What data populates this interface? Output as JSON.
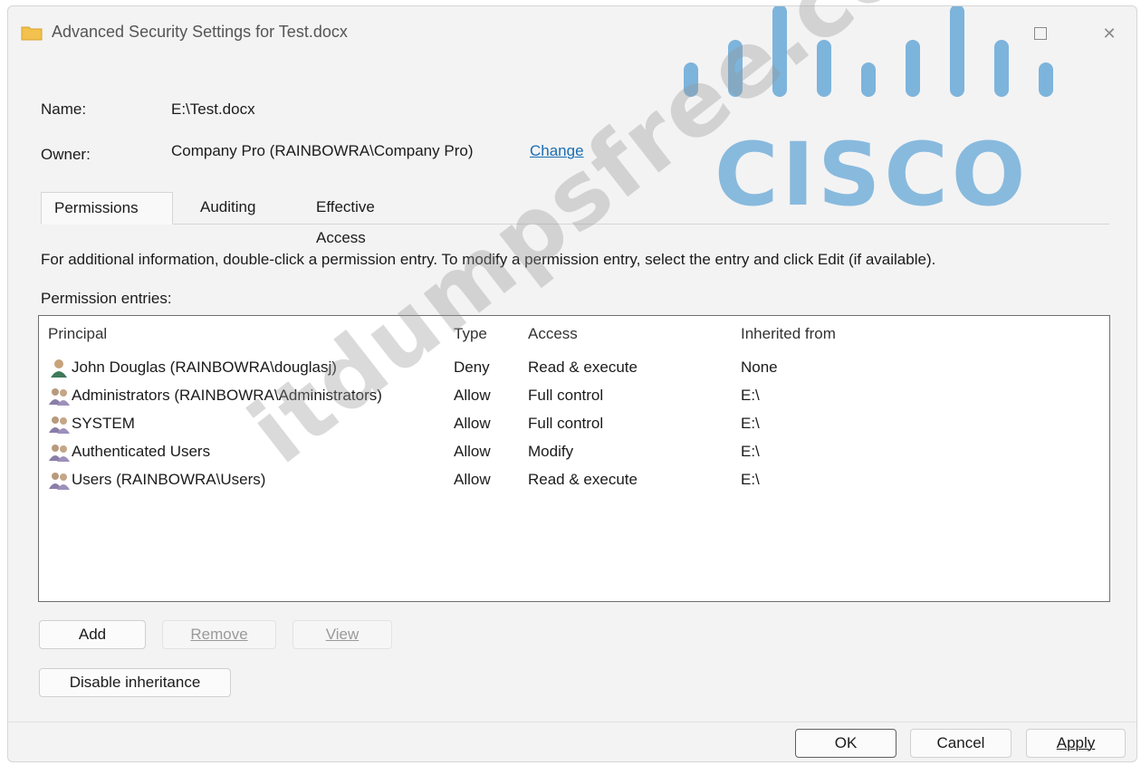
{
  "window": {
    "title": "Advanced Security Settings for Test.docx",
    "maximize_glyph": "☐",
    "close_glyph": "✕"
  },
  "logo": {
    "text": "CISCO",
    "color": "#7db4dc"
  },
  "watermark": {
    "text": "itdumpsfree.com"
  },
  "fields": {
    "name_label": "Name:",
    "name_value": "E:\\Test.docx",
    "owner_label": "Owner:",
    "owner_value": "Company Pro (RAINBOWRA\\Company Pro)",
    "change_label": "Change"
  },
  "tabs": [
    "Permissions",
    "Auditing",
    "Effective Access"
  ],
  "info_text": "For additional information, double-click a permission entry. To modify a permission entry, select the entry and click Edit (if available).",
  "entries_label": "Permission entries:",
  "table": {
    "headers": [
      "Principal",
      "Type",
      "Access",
      "Inherited from"
    ],
    "rows": [
      {
        "icon": "user-icon",
        "principal": "John Douglas (RAINBOWRA\\douglasj)",
        "type": "Deny",
        "access": "Read & execute",
        "inherited": "None"
      },
      {
        "icon": "group-icon",
        "principal": "Administrators (RAINBOWRA\\Administrators)",
        "type": "Allow",
        "access": "Full control",
        "inherited": "E:\\"
      },
      {
        "icon": "group-icon",
        "principal": "SYSTEM",
        "type": "Allow",
        "access": "Full control",
        "inherited": "E:\\"
      },
      {
        "icon": "group-icon",
        "principal": "Authenticated Users",
        "type": "Allow",
        "access": "Modify",
        "inherited": "E:\\"
      },
      {
        "icon": "group-icon",
        "principal": "Users (RAINBOWRA\\Users)",
        "type": "Allow",
        "access": "Read & execute",
        "inherited": "E:\\"
      }
    ]
  },
  "buttons": {
    "add": "Add",
    "remove": "Remove",
    "view": "View",
    "disable_inheritance": "Disable inheritance",
    "ok": "OK",
    "cancel": "Cancel",
    "apply": "Apply"
  }
}
